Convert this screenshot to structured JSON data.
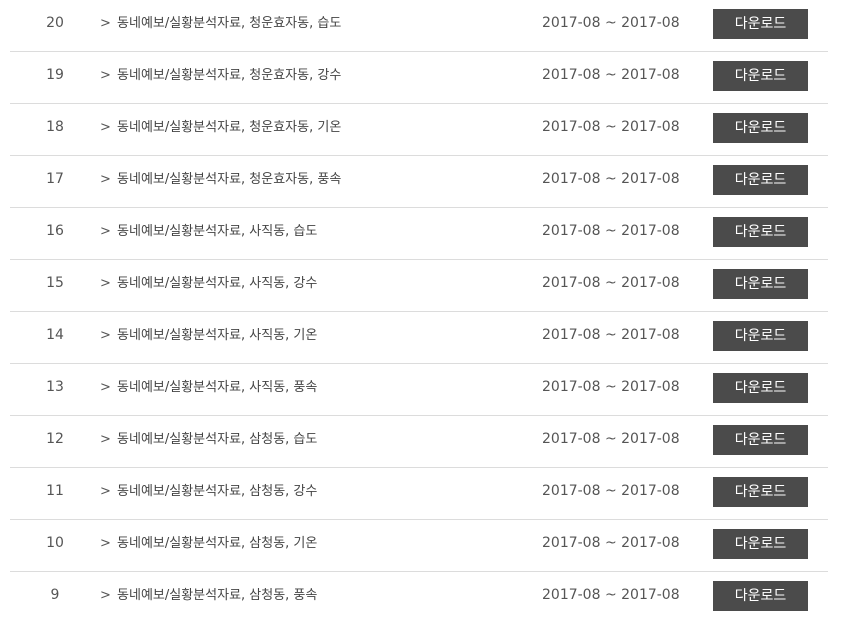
{
  "rows": [
    {
      "num": "20",
      "title": "동네예보/실황분석자료, 청운효자동, 습도",
      "period": "2017-08 ~ 2017-08",
      "button": "다운로드"
    },
    {
      "num": "19",
      "title": "동네예보/실황분석자료, 청운효자동, 강수",
      "period": "2017-08 ~ 2017-08",
      "button": "다운로드"
    },
    {
      "num": "18",
      "title": "동네예보/실황분석자료, 청운효자동, 기온",
      "period": "2017-08 ~ 2017-08",
      "button": "다운로드"
    },
    {
      "num": "17",
      "title": "동네예보/실황분석자료, 청운효자동, 풍속",
      "period": "2017-08 ~ 2017-08",
      "button": "다운로드"
    },
    {
      "num": "16",
      "title": "동네예보/실황분석자료, 사직동, 습도",
      "period": "2017-08 ~ 2017-08",
      "button": "다운로드"
    },
    {
      "num": "15",
      "title": "동네예보/실황분석자료, 사직동, 강수",
      "period": "2017-08 ~ 2017-08",
      "button": "다운로드"
    },
    {
      "num": "14",
      "title": "동네예보/실황분석자료, 사직동, 기온",
      "period": "2017-08 ~ 2017-08",
      "button": "다운로드"
    },
    {
      "num": "13",
      "title": "동네예보/실황분석자료, 사직동, 풍속",
      "period": "2017-08 ~ 2017-08",
      "button": "다운로드"
    },
    {
      "num": "12",
      "title": "동네예보/실황분석자료, 삼청동, 습도",
      "period": "2017-08 ~ 2017-08",
      "button": "다운로드"
    },
    {
      "num": "11",
      "title": "동네예보/실황분석자료, 삼청동, 강수",
      "period": "2017-08 ~ 2017-08",
      "button": "다운로드"
    },
    {
      "num": "10",
      "title": "동네예보/실황분석자료, 삼청동, 기온",
      "period": "2017-08 ~ 2017-08",
      "button": "다운로드"
    },
    {
      "num": "9",
      "title": "동네예보/실황분석자료, 삼청동, 풍속",
      "period": "2017-08 ~ 2017-08",
      "button": "다운로드"
    }
  ],
  "icons": {
    "row_arrow": "chevron-right-icon"
  },
  "colors": {
    "button_bg": "#4b4b4b",
    "button_text": "#ffffff",
    "divider": "#dcdcdc"
  }
}
